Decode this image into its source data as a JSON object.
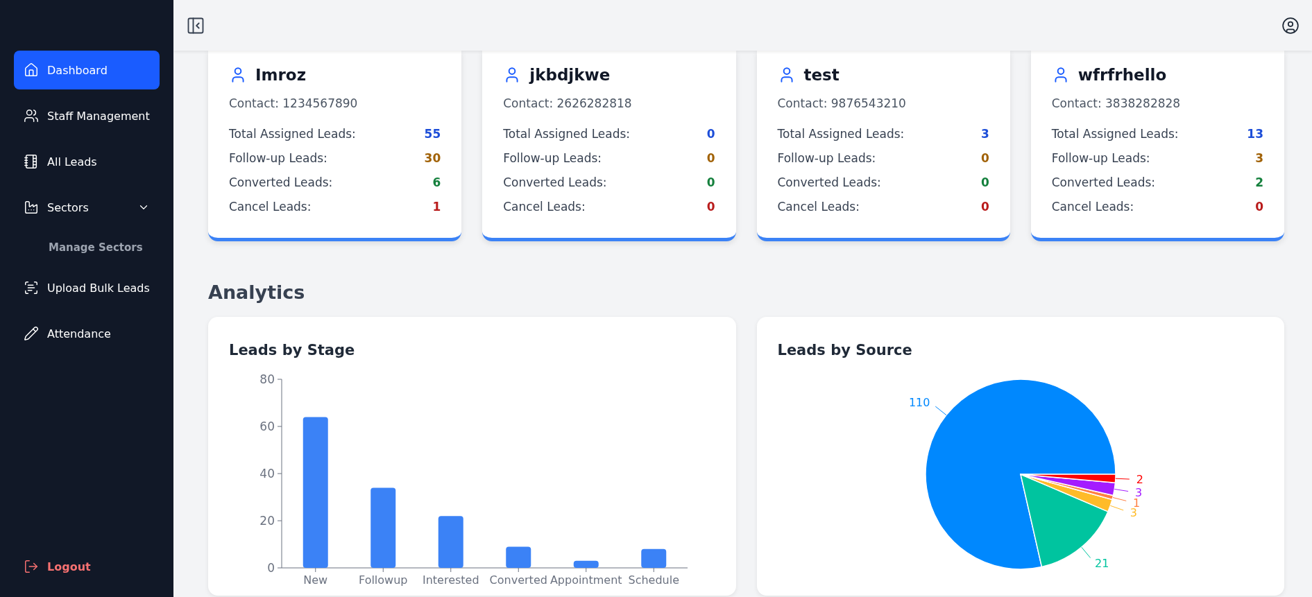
{
  "sidebar": {
    "items": [
      {
        "label": "Dashboard",
        "selected": true
      },
      {
        "label": "Staff Management",
        "selected": false
      },
      {
        "label": "All Leads",
        "selected": false
      },
      {
        "label": "Sectors",
        "selected": false,
        "expanded": true,
        "children": [
          {
            "label": "Manage Sectors",
            "selected": false
          }
        ]
      },
      {
        "label": "Upload Bulk Leads",
        "selected": false
      },
      {
        "label": "Attendance",
        "selected": false
      }
    ],
    "logout": "Logout"
  },
  "staff_cards": [
    {
      "name": "Imroz",
      "contact": "Contact: 1234567890",
      "stats": [
        {
          "label": "Total Assigned Leads:",
          "value": "55",
          "color": "#1d4ed8"
        },
        {
          "label": "Follow-up Leads:",
          "value": "30",
          "color": "#a16207"
        },
        {
          "label": "Converted Leads:",
          "value": "6",
          "color": "#15803d"
        },
        {
          "label": "Cancel Leads:",
          "value": "1",
          "color": "#b91c1c"
        }
      ]
    },
    {
      "name": "jkbdjkwe",
      "contact": "Contact: 2626282818",
      "stats": [
        {
          "label": "Total Assigned Leads:",
          "value": "0",
          "color": "#1d4ed8"
        },
        {
          "label": "Follow-up Leads:",
          "value": "0",
          "color": "#a16207"
        },
        {
          "label": "Converted Leads:",
          "value": "0",
          "color": "#15803d"
        },
        {
          "label": "Cancel Leads:",
          "value": "0",
          "color": "#b91c1c"
        }
      ]
    },
    {
      "name": "test",
      "contact": "Contact: 9876543210",
      "stats": [
        {
          "label": "Total Assigned Leads:",
          "value": "3",
          "color": "#1d4ed8"
        },
        {
          "label": "Follow-up Leads:",
          "value": "0",
          "color": "#a16207"
        },
        {
          "label": "Converted Leads:",
          "value": "0",
          "color": "#15803d"
        },
        {
          "label": "Cancel Leads:",
          "value": "0",
          "color": "#b91c1c"
        }
      ]
    },
    {
      "name": "wfrfrhello",
      "contact": "Contact: 3838282828",
      "stats": [
        {
          "label": "Total Assigned Leads:",
          "value": "13",
          "color": "#1d4ed8"
        },
        {
          "label": "Follow-up Leads:",
          "value": "3",
          "color": "#a16207"
        },
        {
          "label": "Converted Leads:",
          "value": "2",
          "color": "#15803d"
        },
        {
          "label": "Cancel Leads:",
          "value": "0",
          "color": "#b91c1c"
        }
      ]
    }
  ],
  "analytics": {
    "title": "Analytics",
    "stage_chart": {
      "title": "Leads by Stage",
      "chart_data": {
        "type": "bar",
        "categories": [
          "New",
          "Followup",
          "Interested",
          "Converted",
          "Appointment",
          "Schedule"
        ],
        "series": [
          {
            "color": "#3b82f6",
            "values": [
              64,
              34,
              22,
              9,
              3,
              8
            ]
          }
        ],
        "ylim": [
          0,
          80
        ],
        "yticks": [
          0,
          20,
          40,
          60,
          80
        ]
      }
    },
    "source_chart": {
      "title": "Leads by Source",
      "chart_data": {
        "type": "pie",
        "data_labels": true,
        "series": [
          {
            "values": [
              110,
              21,
              3,
              1,
              3,
              2
            ]
          }
        ],
        "colors": [
          "#0088fe",
          "#00c49f",
          "#ffbb28",
          "#ff8042",
          "#a41cff",
          "#ff0000"
        ]
      }
    }
  }
}
